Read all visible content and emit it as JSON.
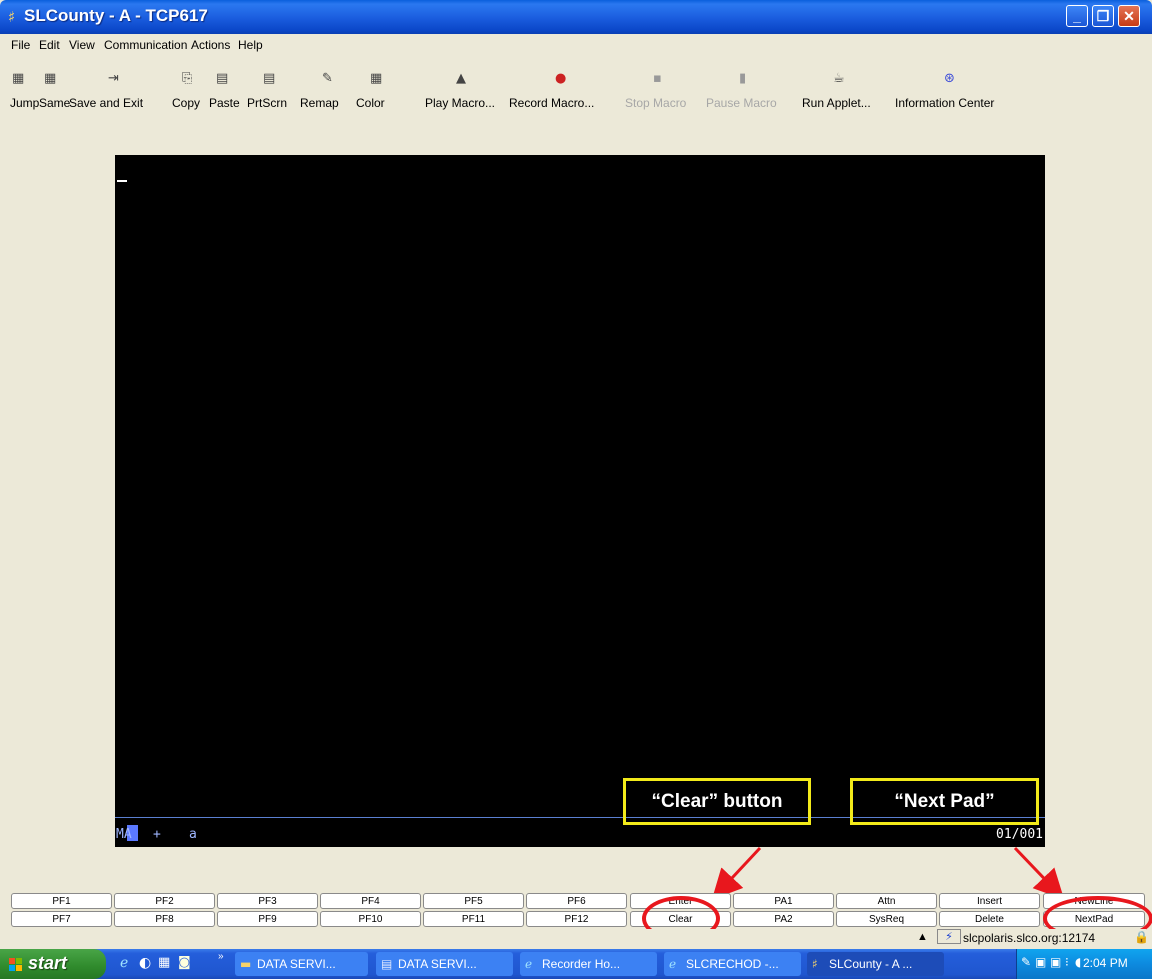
{
  "window": {
    "title": "SLCounty - A - TCP617",
    "controls": [
      "minimize",
      "maximize",
      "close"
    ]
  },
  "menu": [
    "File",
    "Edit",
    "View",
    "Communication",
    "Actions",
    "Help"
  ],
  "toolbar": [
    {
      "label": "Jump",
      "icon": "jump-icon",
      "disabled": false
    },
    {
      "label": "Same",
      "icon": "same-icon",
      "disabled": false
    },
    {
      "label": "Save and Exit",
      "icon": "save-exit-icon",
      "disabled": false
    },
    {
      "label": "Copy",
      "icon": "copy-icon",
      "disabled": false
    },
    {
      "label": "Paste",
      "icon": "paste-icon",
      "disabled": false
    },
    {
      "label": "PrtScrn",
      "icon": "print-screen-icon",
      "disabled": false
    },
    {
      "label": "Remap",
      "icon": "remap-icon",
      "disabled": false
    },
    {
      "label": "Color",
      "icon": "color-icon",
      "disabled": false
    },
    {
      "label": "Play Macro...",
      "icon": "play-macro-icon",
      "disabled": false
    },
    {
      "label": "Record Macro...",
      "icon": "record-macro-icon",
      "disabled": false
    },
    {
      "label": "Stop Macro",
      "icon": "stop-macro-icon",
      "disabled": true
    },
    {
      "label": "Pause Macro",
      "icon": "pause-macro-icon",
      "disabled": true
    },
    {
      "label": "Run Applet...",
      "icon": "run-applet-icon",
      "disabled": false
    },
    {
      "label": "Information Center",
      "icon": "information-center-icon",
      "disabled": false
    }
  ],
  "terminal": {
    "oia_mode": "MA",
    "oia_plus": "+",
    "oia_a": "a",
    "position": "01/001"
  },
  "callouts": {
    "clear": "“Clear” button",
    "nextpad": "“Next Pad”"
  },
  "keypad": {
    "row1": [
      "PF1",
      "PF2",
      "PF3",
      "PF4",
      "PF5",
      "PF6",
      "Enter",
      "PA1",
      "Attn",
      "Insert",
      "NewLine"
    ],
    "row2": [
      "PF7",
      "PF8",
      "PF9",
      "PF10",
      "PF11",
      "PF12",
      "Clear",
      "PA2",
      "SysReq",
      "Delete",
      "NextPad"
    ]
  },
  "status": {
    "host": "slcpolaris.slco.org:12174"
  },
  "taskbar": {
    "start": "start",
    "tasks": [
      {
        "label": "DATA SERVI...",
        "icon": "folder-icon"
      },
      {
        "label": "DATA SERVI...",
        "icon": "word-document-icon"
      },
      {
        "label": "Recorder Ho...",
        "icon": "internet-explorer-icon"
      },
      {
        "label": "SLCRECHOD -...",
        "icon": "internet-explorer-icon"
      },
      {
        "label": "SLCounty - A ...",
        "icon": "terminal-app-icon"
      }
    ],
    "clock": "2:04 PM"
  },
  "colors": {
    "callout_border": "#f2ea1a",
    "oval": "#e8171d",
    "terminal_bg": "#000000"
  }
}
